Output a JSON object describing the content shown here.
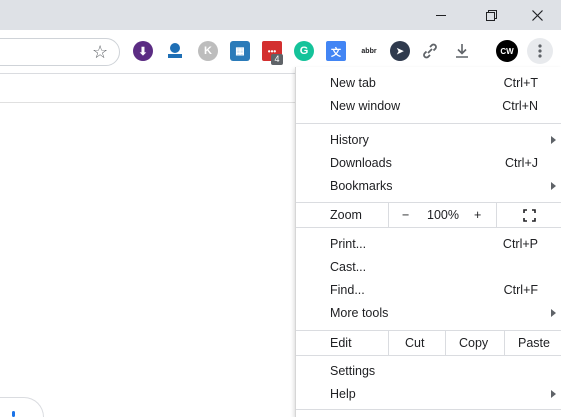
{
  "window": {
    "minimize_icon": "minimize-icon",
    "restore_icon": "restore-icon",
    "close_icon": "close-icon"
  },
  "toolbar": {
    "bookmark_icon": "star-icon",
    "extensions": [
      {
        "name": "download-manager-icon",
        "color": "#5b2c83",
        "glyph": "⬇"
      },
      {
        "name": "ext-upload-icon",
        "color": "#1f6fb5",
        "glyph": "⬆"
      },
      {
        "name": "k-extension-icon",
        "color": "#9e9e9e",
        "glyph": "K"
      },
      {
        "name": "ext-grid-icon",
        "color": "#2b7bb9",
        "glyph": "▦"
      },
      {
        "name": "ext-red-icon",
        "color": "#d32f2f",
        "glyph": "▪",
        "badge": "4"
      },
      {
        "name": "grammarly-icon",
        "color": "#15c39a",
        "glyph": "G"
      },
      {
        "name": "translate-icon",
        "color": "#4285f4",
        "glyph": "文"
      },
      {
        "name": "abbr-extension-icon",
        "color": "#202124",
        "glyph": "abbr"
      },
      {
        "name": "cursor-extension-icon",
        "color": "#2f3a4d",
        "glyph": "➤"
      },
      {
        "name": "link-icon",
        "color": "#5f6368",
        "glyph": "🔗"
      },
      {
        "name": "download-icon",
        "color": "#5f6368",
        "glyph": "⤓"
      },
      {
        "name": "profile-avatar-icon",
        "color": "#000000",
        "glyph": "CW"
      },
      {
        "name": "more-menu-icon",
        "color": "#5f6368",
        "glyph": "⋮"
      }
    ]
  },
  "menu": {
    "new_tab": {
      "label": "New tab",
      "shortcut": "Ctrl+T"
    },
    "new_window": {
      "label": "New window",
      "shortcut": "Ctrl+N"
    },
    "history": {
      "label": "History"
    },
    "downloads": {
      "label": "Downloads",
      "shortcut": "Ctrl+J"
    },
    "bookmarks": {
      "label": "Bookmarks"
    },
    "zoom": {
      "label": "Zoom",
      "minus": "−",
      "level": "100%",
      "plus": "+",
      "fullscreen_icon": "fullscreen-icon"
    },
    "print": {
      "label": "Print...",
      "shortcut": "Ctrl+P"
    },
    "cast": {
      "label": "Cast..."
    },
    "find": {
      "label": "Find...",
      "shortcut": "Ctrl+F"
    },
    "more_tools": {
      "label": "More tools"
    },
    "edit": {
      "label": "Edit",
      "cut": "Cut",
      "copy": "Copy",
      "paste": "Paste"
    },
    "settings": {
      "label": "Settings"
    },
    "help": {
      "label": "Help"
    }
  }
}
